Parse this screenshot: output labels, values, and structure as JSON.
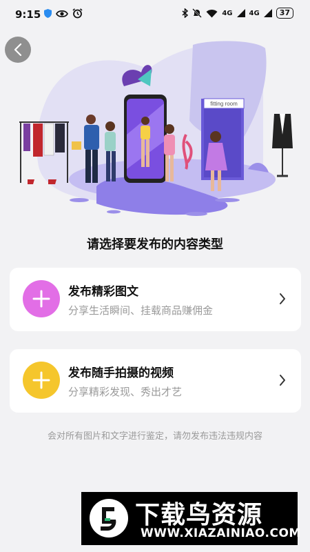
{
  "status_bar": {
    "time": "9:15",
    "signal1": "4G",
    "signal2": "4G",
    "battery": "37"
  },
  "hero": {
    "sign_text": "fitting room"
  },
  "prompt_title": "请选择要发布的内容类型",
  "cards": [
    {
      "title": "发布精彩图文",
      "subtitle": "分享生活瞬间、挂载商品赚佣金",
      "icon": "plus-icon",
      "icon_color": "#e26ee6"
    },
    {
      "title": "发布随手拍摄的视频",
      "subtitle": "分享精彩发现、秀出才艺",
      "icon": "plus-icon",
      "icon_color": "#f5c62c"
    }
  ],
  "notice": "会对所有图片和文字进行鉴定，请勿发布违法违规内容",
  "watermark": {
    "title": "下载鸟资源",
    "url": "WWW.XIAZAINIAO.COM"
  }
}
